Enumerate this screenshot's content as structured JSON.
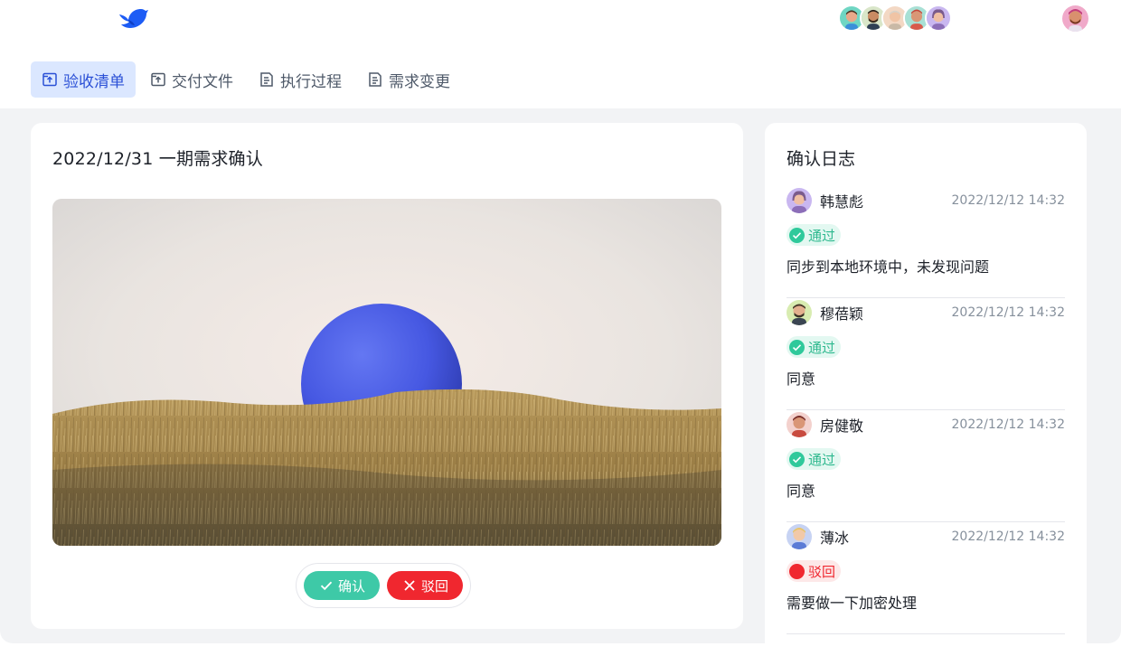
{
  "tabs": [
    {
      "label": "验收清单",
      "icon": "upload-file-icon",
      "active": true
    },
    {
      "label": "交付文件",
      "icon": "upload-file-icon",
      "active": false
    },
    {
      "label": "执行过程",
      "icon": "document-icon",
      "active": false
    },
    {
      "label": "需求变更",
      "icon": "document-icon",
      "active": false
    }
  ],
  "main": {
    "title": "2022/12/31 一期需求确认",
    "image": "blue-sphere-in-grass",
    "confirm_label": "确认",
    "reject_label": "驳回"
  },
  "log": {
    "title": "确认日志",
    "entries": [
      {
        "name": "韩慧彪",
        "time": "2022/12/12 14:32",
        "status": "通过",
        "status_type": "pass",
        "comment": "同步到本地环境中，未发现问题"
      },
      {
        "name": "穆蓓颖",
        "time": "2022/12/12 14:32",
        "status": "通过",
        "status_type": "pass",
        "comment": "同意"
      },
      {
        "name": "房健敬",
        "time": "2022/12/12 14:32",
        "status": "通过",
        "status_type": "pass",
        "comment": "同意"
      },
      {
        "name": "薄冰",
        "time": "2022/12/12 14:32",
        "status": "驳回",
        "status_type": "reject",
        "comment": "需要做一下加密处理"
      }
    ]
  },
  "colors": {
    "accent": "#2b50d6",
    "tab_active_bg": "#dbe7ff",
    "pass": "#3ec9a7",
    "reject": "#f0272f"
  }
}
